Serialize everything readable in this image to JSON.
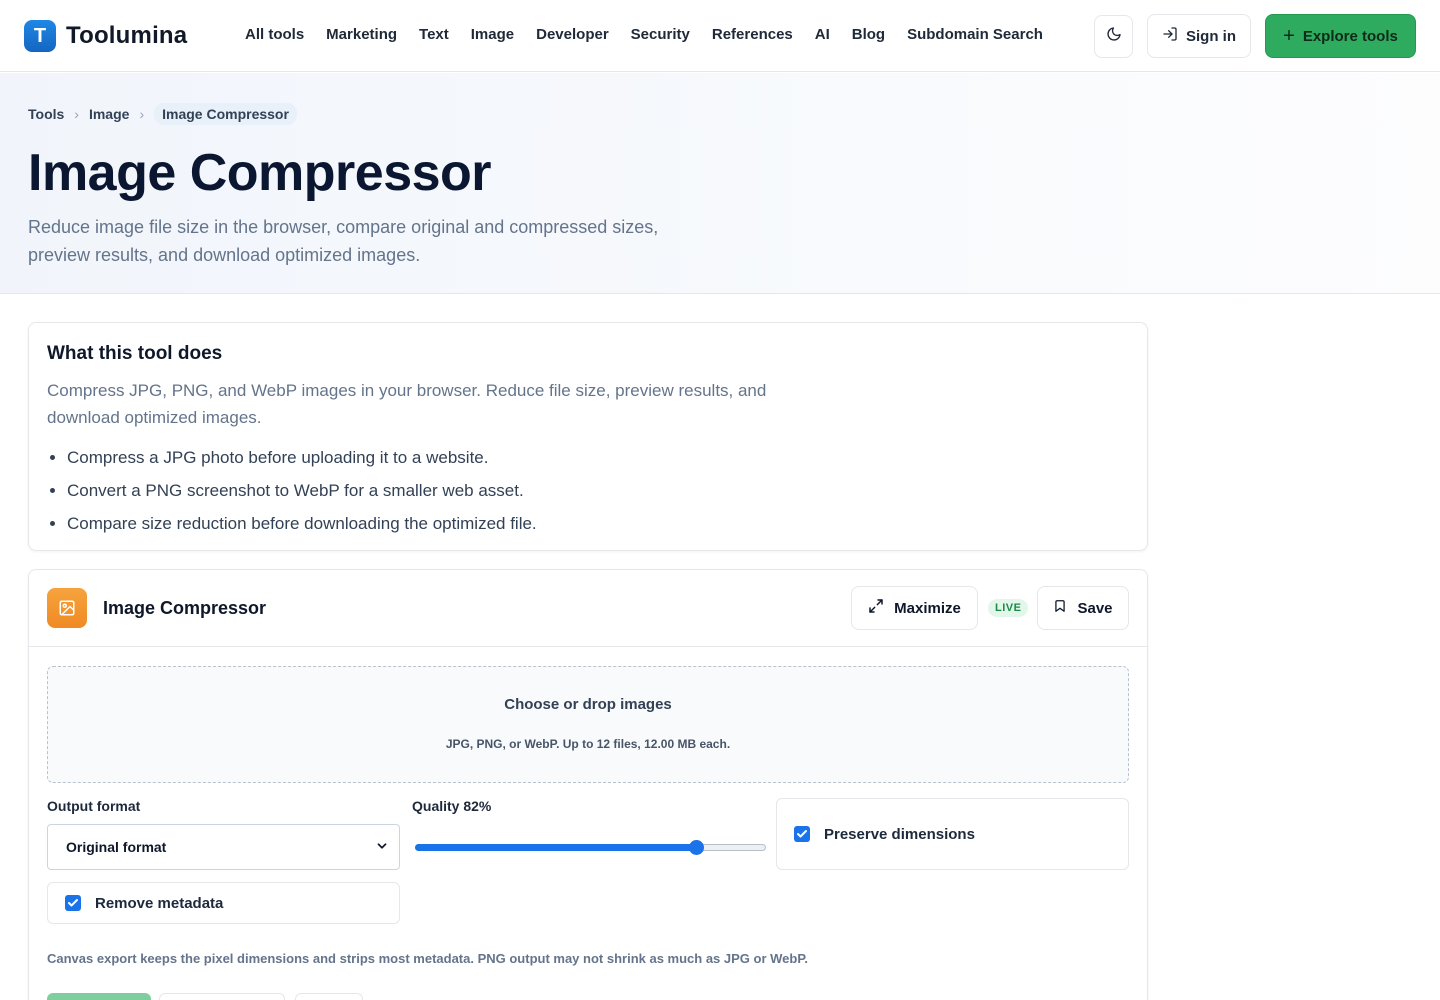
{
  "header": {
    "logo_letter": "T",
    "brand": "Toolumina",
    "nav": [
      "All tools",
      "Marketing",
      "Text",
      "Image",
      "Developer",
      "Security",
      "References",
      "AI",
      "Blog",
      "Subdomain Search"
    ],
    "theme_icon": "moon-icon",
    "sign_in_label": "Sign in",
    "explore_label": "Explore tools"
  },
  "hero": {
    "breadcrumb": [
      "Tools",
      "Image",
      "Image Compressor"
    ],
    "title": "Image Compressor",
    "description": "Reduce image file size in the browser, compare original and compressed sizes, preview results, and download optimized images."
  },
  "info": {
    "title": "What this tool does",
    "text": "Compress JPG, PNG, and WebP images in your browser. Reduce file size, preview results, and download optimized images.",
    "bullets": [
      "Compress a JPG photo before uploading it to a website.",
      "Convert a PNG screenshot to WebP for a smaller web asset.",
      "Compare size reduction before downloading the optimized file."
    ]
  },
  "tool": {
    "name": "Image Compressor",
    "maximize_label": "Maximize",
    "live_badge": "LIVE",
    "save_label": "Save",
    "drop_title": "Choose or drop images",
    "drop_subtitle": "JPG, PNG, or WebP. Up to 12 files, 12.00 MB each.",
    "output_format_label": "Output format",
    "output_format_value": "Original format",
    "quality_label": "Quality 82%",
    "quality_value": 82,
    "preserve_label": "Preserve dimensions",
    "preserve_checked": true,
    "metadata_label": "Remove metadata",
    "metadata_checked": true,
    "note": "Canvas export keeps the pixel dimensions and strips most metadata. PNG output may not shrink as much as JPG or WebP."
  },
  "colors": {
    "accent_green": "#2eab5f",
    "accent_blue": "#1a73e8",
    "tool_icon_orange": "#f08a24"
  }
}
